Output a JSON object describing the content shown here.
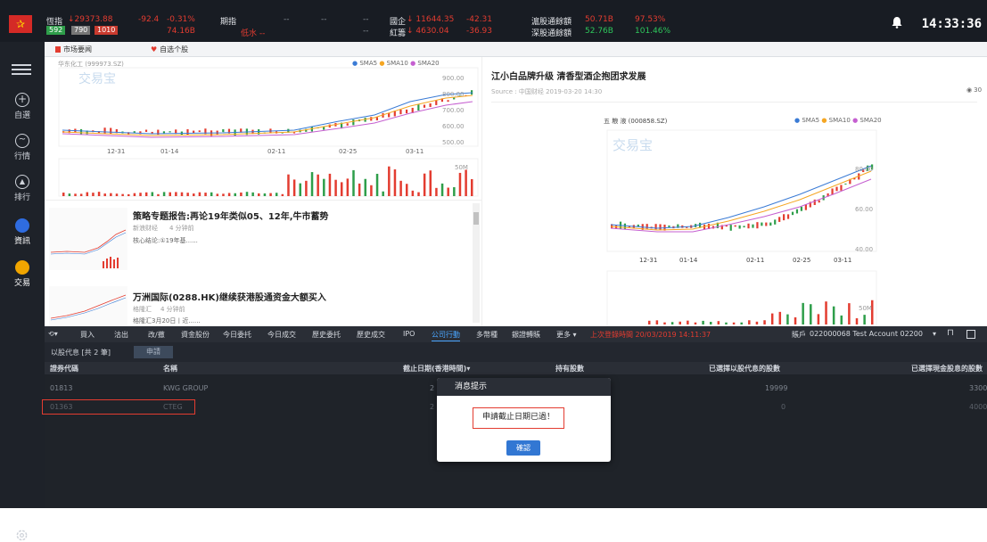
{
  "app": {
    "logo_char": "✰",
    "clock": "14:33:36"
  },
  "ticker": {
    "hsi": {
      "label": "恆指",
      "value": "↓29373.88",
      "chg": "-92.4",
      "pct": "-0.31%",
      "sub1": "592",
      "sub2": "790",
      "sub3": "1010",
      "turnover": "74.16B"
    },
    "futures": {
      "label": "期指",
      "v1": "--",
      "v2": "--",
      "v3": "--",
      "sub": "低水 --"
    },
    "hscei": {
      "label": "國企",
      "value": "↓ 11644.35",
      "chg": "-42.31"
    },
    "redchip": {
      "label": "紅籌",
      "value": "↓ 4630.04",
      "chg": "-36.93"
    },
    "sh_connect": {
      "label": "滬股通餘額",
      "value": "50.71B",
      "pct": "97.53%"
    },
    "sz_connect": {
      "label": "深股通餘額",
      "value": "52.76B",
      "pct": "101.46%"
    }
  },
  "sidebar": {
    "items": [
      {
        "label": "自選",
        "icon": "plus-circle-icon"
      },
      {
        "label": "行情",
        "icon": "chart-wave-icon"
      },
      {
        "label": "排行",
        "icon": "ranking-icon"
      },
      {
        "label": "資訊",
        "icon": "news-icon"
      },
      {
        "label": "交易",
        "icon": "trade-icon"
      }
    ]
  },
  "tabs": [
    {
      "label": "市场要闻"
    },
    {
      "label": "自选个股"
    }
  ],
  "chart_panel": {
    "title": "华东化工 (999973.SZ)",
    "legend": [
      "SMA5",
      "SMA10",
      "SMA20"
    ],
    "legend_colors": [
      "#3a7bd5",
      "#f5a623",
      "#c55fd0"
    ],
    "watermark": "交易宝",
    "yticks": [
      "900.00",
      "800.00",
      "700.00",
      "600.00",
      "500.00"
    ],
    "xticks": [
      "12-31",
      "01-14",
      "02-11",
      "02-25",
      "03-11"
    ],
    "vol_label": "50M"
  },
  "news": [
    {
      "title": "策略专题报告:再论19年类似05、12年,牛市蓄势",
      "source": "新浪财经",
      "time": "4 分钟前",
      "summary": "核心结论:①19年基......"
    },
    {
      "title": "万洲国际(0288.HK)继续获港股通资金大额买入",
      "source": "格隆汇",
      "time": "4 分钟前",
      "summary": "格隆汇3月20日丨近......"
    }
  ],
  "article": {
    "title": "江小白品牌升级 清香型酒企抱团求发展",
    "source": "Source : 中国财经 2019-03-20 14:30",
    "views": "30",
    "chart_title": "五 粮 液 (000858.SZ)",
    "legend": [
      "SMA5",
      "SMA10",
      "SMA20"
    ],
    "yticks": [
      "80.00",
      "60.00",
      "40.00"
    ],
    "xticks": [
      "12-31",
      "01-14",
      "02-11",
      "02-25",
      "03-11"
    ],
    "vol_label": "50M"
  },
  "toolbar": {
    "items": [
      "買入",
      "沽出",
      "改/撤",
      "資金股份",
      "今日委托",
      "今日成交",
      "歷史委托",
      "歷史成交",
      "IPO",
      "公司行動",
      "多幣種",
      "銀證轉賬",
      "更多"
    ],
    "last_login": "上次登錄時間 20/03/2019 14:11:37",
    "account_label": "賬戶",
    "account_value": "022000068 Test Account 02200"
  },
  "subhead": {
    "title": "以股代息 [共 2 筆]",
    "button": "申請"
  },
  "table": {
    "headers": [
      "證券代碼",
      "名稱",
      "截止日期(香港時間)",
      "持有股數",
      "已選擇以股代息的股數",
      "已選擇現金股息的股數"
    ],
    "rows": [
      {
        "code": "01813",
        "name": "KWG GROUP",
        "date": "2",
        "shares": "",
        "scrip": "19999",
        "cash": "3300"
      },
      {
        "code": "01363",
        "name": "CTEG",
        "date": "2",
        "shares": "",
        "scrip": "0",
        "cash": "4000"
      }
    ]
  },
  "modal": {
    "title": "消息提示",
    "message": "申請截止日期已過！",
    "confirm": "確認"
  }
}
